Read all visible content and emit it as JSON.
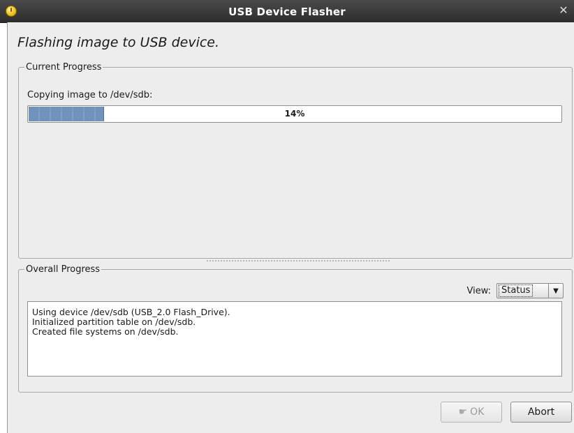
{
  "window": {
    "title": "USB Device Flasher"
  },
  "heading": "Flashing image to USB device.",
  "current_progress": {
    "legend": "Current Progress",
    "label": "Copying image to /dev/sdb:",
    "percent_text": "14%",
    "percent_value": 14,
    "bar_color": "#6f93bd"
  },
  "overall_progress": {
    "legend": "Overall Progress",
    "view_label": "View:",
    "view_selected": "Status",
    "log_lines": [
      "Using device /dev/sdb (USB_2.0 Flash_Drive).",
      "Initialized partition table on /dev/sdb.",
      "Created file systems on /dev/sdb."
    ]
  },
  "buttons": {
    "ok_label": "OK",
    "abort_label": "Abort"
  },
  "icons": {
    "app": "app-warning-icon",
    "close": "close-icon",
    "ok": "ok-gesture-icon",
    "dropdown": "chevron-down-icon"
  }
}
